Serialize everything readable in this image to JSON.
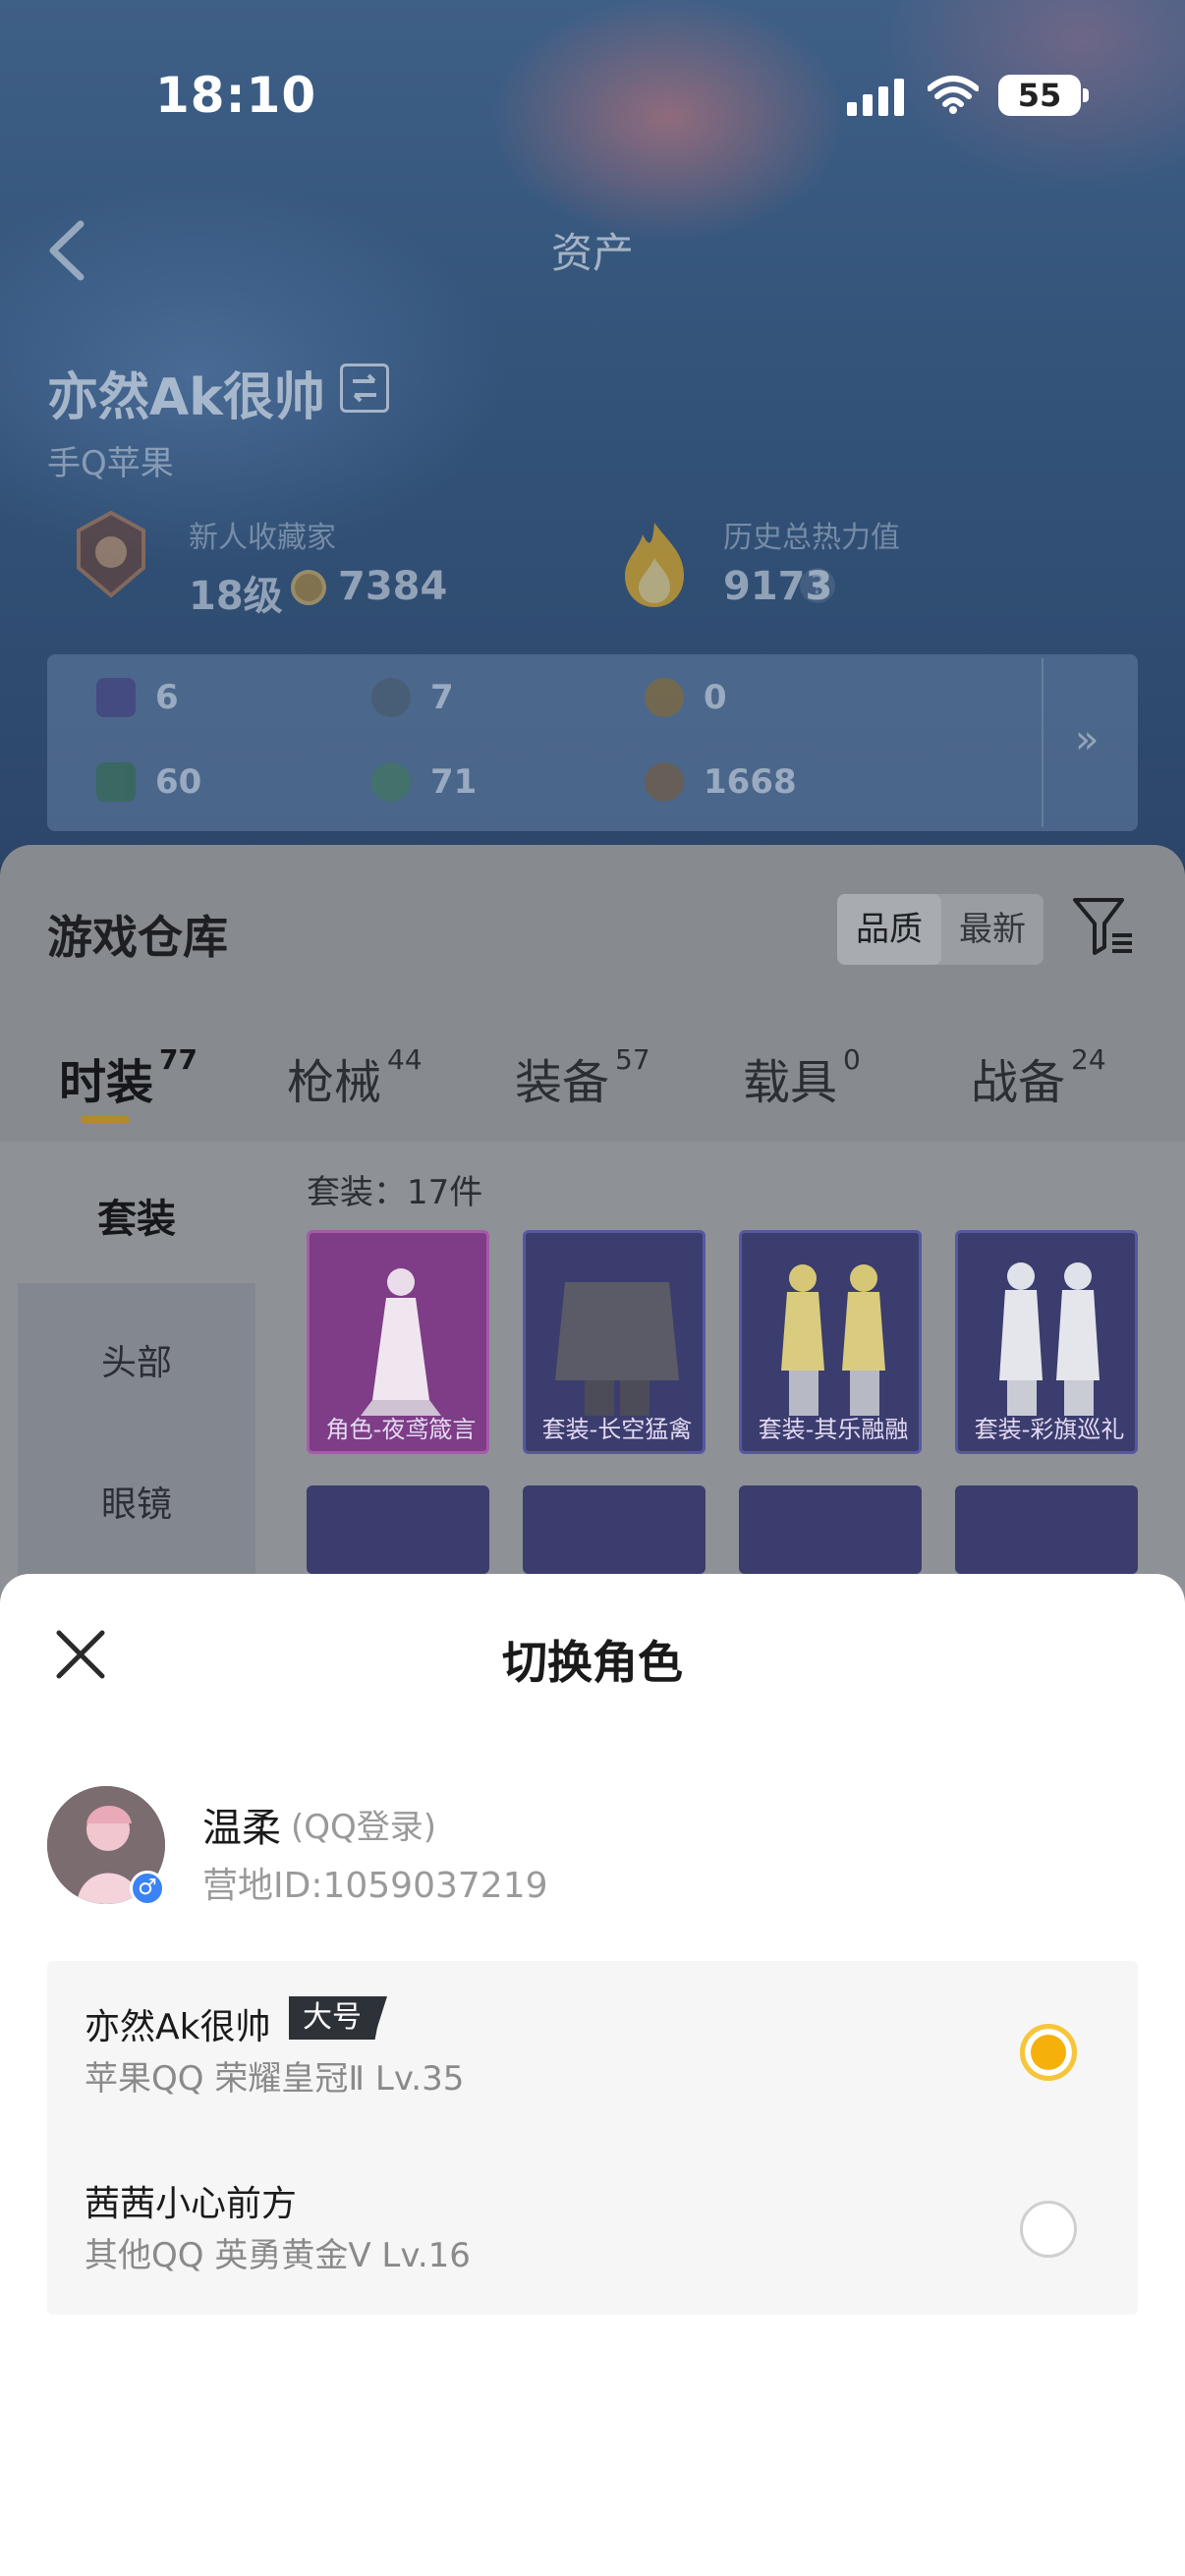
{
  "status_bar": {
    "time": "18:10",
    "battery": "55"
  },
  "header": {
    "title": "资产"
  },
  "player": {
    "name": "亦然Ak很帅",
    "platform": "手Q苹果",
    "rank_title": "新人收藏家",
    "rank_level": "18级",
    "coins": "7384",
    "heat_title": "历史总热力值",
    "heat_value": "9173",
    "heat_help": "?"
  },
  "assets": [
    {
      "value": "6",
      "color": "#3f3a7a"
    },
    {
      "value": "7",
      "color": "#47596b"
    },
    {
      "value": "0",
      "color": "#8a6a2a"
    },
    {
      "value": "60",
      "color": "#2f6a4a"
    },
    {
      "value": "71",
      "color": "#3f7a5a"
    },
    {
      "value": "1668",
      "color": "#7a5a3a"
    }
  ],
  "assets_more": "»",
  "warehouse": {
    "title": "游戏仓库",
    "sort_quality": "品质",
    "sort_newest": "最新",
    "tabs": [
      {
        "label": "时装",
        "count": "77"
      },
      {
        "label": "枪械",
        "count": "44"
      },
      {
        "label": "装备",
        "count": "57"
      },
      {
        "label": "载具",
        "count": "0"
      },
      {
        "label": "战备",
        "count": "24"
      }
    ],
    "side_items": [
      "套装",
      "头部",
      "眼镜"
    ],
    "count_label": "套装：17件",
    "items": [
      {
        "caption": "角色-夜鸢箴言",
        "color": "#9a3aa0"
      },
      {
        "caption": "套装-长空猛禽",
        "color": "#3d3f86"
      },
      {
        "caption": "套装-其乐融融",
        "color": "#3d3f86"
      },
      {
        "caption": "套装-彩旗巡礼",
        "color": "#3d3f86"
      }
    ]
  },
  "sheet": {
    "title": "切换角色",
    "user_name": "温柔",
    "user_login": "(QQ登录)",
    "user_id": "营地ID:1059037219",
    "gender": "♂",
    "roles": [
      {
        "name": "亦然Ak很帅",
        "badge": "大号",
        "meta": "苹果QQ   荣耀皇冠Ⅱ   Lv.35",
        "selected": true
      },
      {
        "name": "茜茜小心前方",
        "badge": "",
        "meta": "其他QQ   英勇黄金Ⅴ   Lv.16",
        "selected": false
      }
    ]
  },
  "colors": {
    "accent": "#f5b00a",
    "dim_overlay": "#878b90"
  }
}
